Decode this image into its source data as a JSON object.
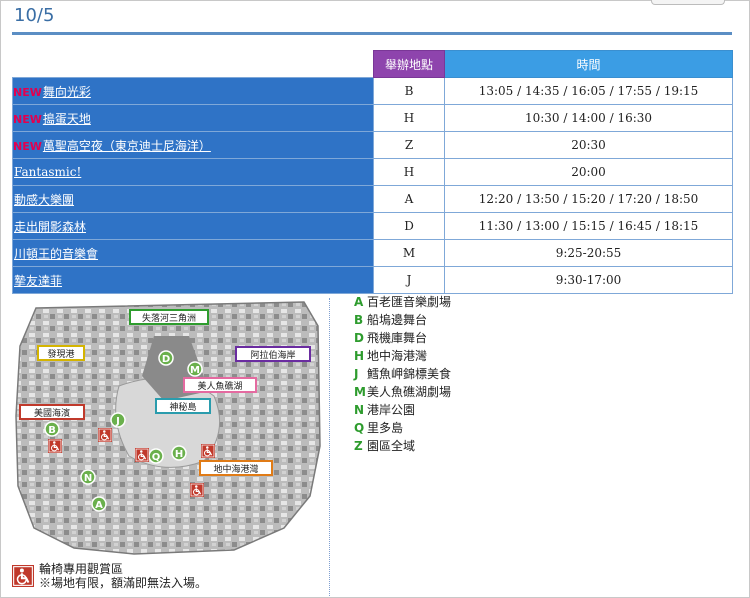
{
  "date": "10/5",
  "table": {
    "header_place": "舉辦地點",
    "header_time": "時間",
    "rows": [
      {
        "new": "NEW",
        "name": "舞向光彩",
        "place": "B",
        "time": "13:05 / 14:35 / 16:05 / 17:55 / 19:15"
      },
      {
        "new": "NEW",
        "name": "搗蛋天地",
        "place": "H",
        "time": "10:30 / 14:00 / 16:30"
      },
      {
        "new": "NEW",
        "name": "萬聖高空夜（東京迪士尼海洋）",
        "place": "Z",
        "time": "20:30"
      },
      {
        "new": "",
        "name": "Fantasmic!",
        "place": "H",
        "time": "20:00"
      },
      {
        "new": "",
        "name": "動感大樂團",
        "place": "A",
        "time": "12:20 / 13:50 / 15:20 / 17:20 / 18:50"
      },
      {
        "new": "",
        "name": "走出開影森林",
        "place": "D",
        "time": "11:30 / 13:00 / 15:15 / 16:45 / 18:15"
      },
      {
        "new": "",
        "name": "川頓王的音樂會",
        "place": "M",
        "time": "9:25-20:55"
      },
      {
        "new": "",
        "name": "摯友達菲",
        "place": "J",
        "time": "9:30-17:00"
      }
    ]
  },
  "map": {
    "labels": {
      "lost_river": "失落河三角洲",
      "discovery": "發現港",
      "arabian": "阿拉伯海岸",
      "mermaid": "美人魚礁湖",
      "american": "美國海濱",
      "mysterious": "神秘島",
      "mediterranean": "地中海港灣"
    },
    "markers": [
      "A",
      "B",
      "D",
      "H",
      "J",
      "M",
      "N",
      "Q"
    ]
  },
  "legend": [
    {
      "code": "A",
      "text": "百老匯音樂劇場"
    },
    {
      "code": "B",
      "text": "船塢邊舞台"
    },
    {
      "code": "D",
      "text": "飛機庫舞台"
    },
    {
      "code": "H",
      "text": "地中海港灣"
    },
    {
      "code": "J",
      "text": "鱈魚岬錦標美食"
    },
    {
      "code": "M",
      "text": "美人魚礁湖劇場"
    },
    {
      "code": "N",
      "text": "港岸公園"
    },
    {
      "code": "Q",
      "text": "里多島"
    },
    {
      "code": "Z",
      "text": "園區全域"
    }
  ],
  "footnote": {
    "line1": "輪椅專用觀賞區",
    "line2": "※場地有限，額滿即無法入場。"
  },
  "colors": {
    "row_bg": "#2f73c6",
    "header_place": "#8e44ad",
    "header_time": "#3b9de4",
    "new_badge": "#e3004f",
    "marker_green": "#6ab04c",
    "wheelchair_red": "#c0392b"
  }
}
